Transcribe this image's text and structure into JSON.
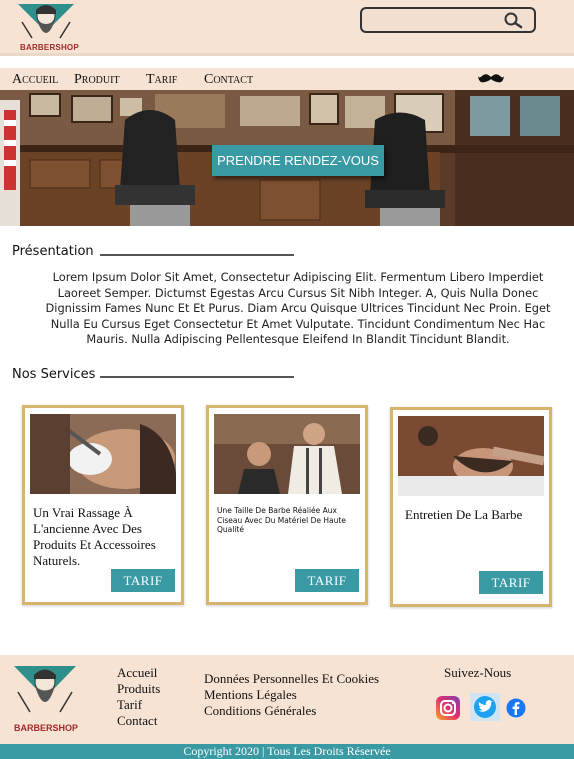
{
  "header": {
    "logo_text": "BARBERSHOP",
    "search_placeholder": ""
  },
  "nav": {
    "items": [
      "Accueil",
      "Produit",
      "Tarif",
      "Contact"
    ]
  },
  "hero": {
    "cta_label": "PRENDRE RENDEZ-VOUS"
  },
  "presentation": {
    "title": "Présentation",
    "text": "Lorem Ipsum Dolor Sit Amet, Consectetur Adipiscing Elit. Fermentum Libero Imperdiet Laoreet Semper. Dictumst Egestas Arcu Cursus Sit Nibh Integer. A, Quis Nulla Donec Dignissim Fames Nunc Et Et Purus. Diam Arcu Quisque Ultrices Tincidunt Nec Proin. Eget Nulla Eu Cursus Eget Consectetur Et Amet Vulputate. Tincidunt Condimentum Nec Hac Mauris. Nulla Adipiscing Pellentesque Eleifend In Blandit Tincidunt Blandit."
  },
  "services": {
    "title": "Nos Services",
    "cards": [
      {
        "text": "Un Vrai Rassage À L'ancienne Avec Des Produits Et Accessoires Naturels.",
        "button": "TARIF"
      },
      {
        "text": "Une Taille De Barbe Réaliée Aux Ciseau Avec Du Matériel De Haute Qualité",
        "button": "TARIF"
      },
      {
        "text": "Entretien De La Barbe",
        "button": "TARIF"
      }
    ]
  },
  "footer": {
    "logo_text": "BARBERSHOP",
    "links1": [
      "Accueil",
      "Produits",
      "Tarif",
      "Contact"
    ],
    "links2": [
      "Données Personnelles Et Cookies",
      "Mentions Légales",
      "Conditions Générales"
    ],
    "follow": "Suivez-Nous",
    "social": [
      "instagram-icon",
      "twitter-icon",
      "facebook-icon"
    ],
    "copyright": "Copyright 2020 | Tous Les Droits Réservée"
  },
  "colors": {
    "header_bg": "#f7e3d3",
    "accent": "#3a9aa4",
    "card_border": "#d7b56d"
  }
}
